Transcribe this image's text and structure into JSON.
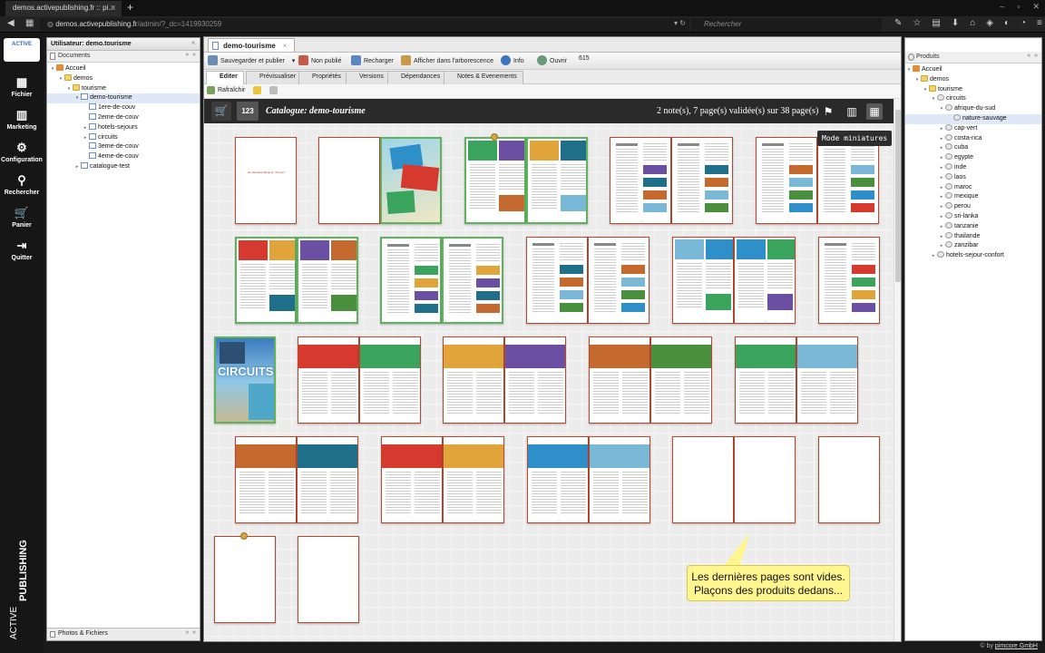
{
  "browser": {
    "tab_title": "demos.activepublishing.fr :: pi...",
    "tab_close": "✕",
    "new_tab": "+",
    "url_host": "demos.activepublishing.fr",
    "url_path": "/admin/?_dc=1419930259",
    "search_placeholder": "Rechercher"
  },
  "leftnav": {
    "logo": "ACTIVE",
    "items": [
      {
        "label": "Fichier",
        "icon": "▦"
      },
      {
        "label": "Marketing",
        "icon": "▥"
      },
      {
        "label": "Configuration",
        "icon": "⚙"
      },
      {
        "label": "Rechercher",
        "icon": "⚲"
      },
      {
        "label": "Panier",
        "icon": "🛒"
      },
      {
        "label": "Quitter",
        "icon": "⇥"
      }
    ],
    "brand_active": "ACTIVE",
    "brand_publishing": "PUBLISHING"
  },
  "left_panel": {
    "title": "Utilisateur: demo.tourisme",
    "section": "Documents",
    "tree": [
      {
        "label": "Accueil",
        "level": 0,
        "toggle": "▾",
        "icon": "home"
      },
      {
        "label": "demos",
        "level": 1,
        "toggle": "▾",
        "icon": "folder"
      },
      {
        "label": "tourisme",
        "level": 2,
        "toggle": "▾",
        "icon": "folder"
      },
      {
        "label": "demo-tourisme",
        "level": 3,
        "toggle": "▾",
        "icon": "doc",
        "selected": true
      },
      {
        "label": "1ere-de-couv",
        "level": 4,
        "toggle": "",
        "icon": "doc"
      },
      {
        "label": "2eme-de-couv",
        "level": 4,
        "toggle": "",
        "icon": "doc"
      },
      {
        "label": "hotels-sejours",
        "level": 4,
        "toggle": "▸",
        "icon": "doc"
      },
      {
        "label": "circuits",
        "level": 4,
        "toggle": "▸",
        "icon": "doc"
      },
      {
        "label": "3eme-de-couv",
        "level": 4,
        "toggle": "",
        "icon": "doc"
      },
      {
        "label": "4eme-de-couv",
        "level": 4,
        "toggle": "",
        "icon": "doc"
      },
      {
        "label": "catalogue-test",
        "level": 3,
        "toggle": "▸",
        "icon": "doc"
      }
    ],
    "footer": "Photos & Fichiers"
  },
  "right_panel": {
    "title": "Produits",
    "tree": [
      {
        "label": "Accueil",
        "level": 0,
        "toggle": "▾",
        "icon": "home"
      },
      {
        "label": "demos",
        "level": 1,
        "toggle": "▾",
        "icon": "folder"
      },
      {
        "label": "tourisme",
        "level": 2,
        "toggle": "▾",
        "icon": "folder"
      },
      {
        "label": "circuits",
        "level": 3,
        "toggle": "▾",
        "icon": "obj"
      },
      {
        "label": "afrique-du-sud",
        "level": 4,
        "toggle": "▾",
        "icon": "obj"
      },
      {
        "label": "nature-sauvage",
        "level": 5,
        "toggle": "",
        "icon": "obj",
        "selected": true
      },
      {
        "label": "cap-vert",
        "level": 4,
        "toggle": "▸",
        "icon": "obj"
      },
      {
        "label": "costa-rica",
        "level": 4,
        "toggle": "▸",
        "icon": "obj"
      },
      {
        "label": "cuba",
        "level": 4,
        "toggle": "▸",
        "icon": "obj"
      },
      {
        "label": "egypte",
        "level": 4,
        "toggle": "▸",
        "icon": "obj"
      },
      {
        "label": "inde",
        "level": 4,
        "toggle": "▸",
        "icon": "obj"
      },
      {
        "label": "laos",
        "level": 4,
        "toggle": "▸",
        "icon": "obj"
      },
      {
        "label": "maroc",
        "level": 4,
        "toggle": "▸",
        "icon": "obj"
      },
      {
        "label": "mexique",
        "level": 4,
        "toggle": "▸",
        "icon": "obj"
      },
      {
        "label": "perou",
        "level": 4,
        "toggle": "▸",
        "icon": "obj"
      },
      {
        "label": "sri-lanka",
        "level": 4,
        "toggle": "▸",
        "icon": "obj"
      },
      {
        "label": "tanzanie",
        "level": 4,
        "toggle": "▸",
        "icon": "obj"
      },
      {
        "label": "thailande",
        "level": 4,
        "toggle": "▸",
        "icon": "obj"
      },
      {
        "label": "zanzibar",
        "level": 4,
        "toggle": "▸",
        "icon": "obj"
      },
      {
        "label": "hotels-sejour-confort",
        "level": 3,
        "toggle": "▸",
        "icon": "obj"
      }
    ]
  },
  "editor": {
    "doc_tab": "demo-tourisme",
    "toolbar": {
      "save_publish": "Sauvegarder et publier",
      "unpublish": "Non publié",
      "reload": "Recharger",
      "show_tree": "Afficher dans l'arborescence",
      "info": "Info",
      "open": "Ouvrir",
      "id": "615"
    },
    "tabs": [
      "Editer",
      "Prévisualiser",
      "Propriétés",
      "Versions",
      "Dépendances",
      "Notes & Evenements"
    ],
    "refresh": "Rafraîchir"
  },
  "catalog": {
    "title": "Catalogue: demo-tourisme",
    "num_button": "123",
    "status": "2 note(s), 7 page(s) validée(s) sur 38 page(s)",
    "tooltip": "Mode miniatures",
    "circuits_label": "CIRCUITS",
    "cover_text": "En attendant Bonjour \"Trouver\"",
    "callout": "Les dernières pages sont vides. Plaçons des produits dedans..."
  },
  "footer": {
    "prefix": "© by",
    "link": "pimcore GmbH"
  },
  "colors": {
    "validated_border": "#5fb35f",
    "pending_border": "#b5492f",
    "callout_bg": "#fff68f",
    "header_bg": "#2a2a2a"
  }
}
